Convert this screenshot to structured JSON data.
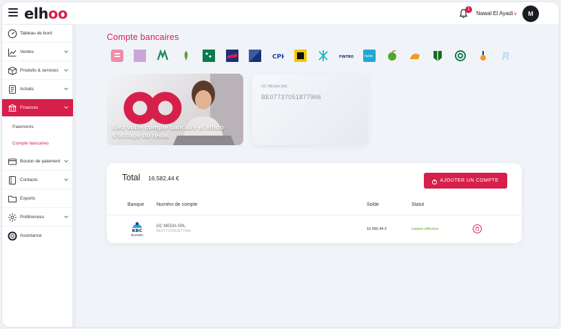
{
  "header": {
    "logo": {
      "prefix": "elh",
      "accent": "oo"
    },
    "notifications_count": "1",
    "user_name": "Nawal El Ayadi",
    "avatar_initials": "M"
  },
  "sidebar": {
    "items": [
      {
        "label": "Tableau de bord",
        "icon": "dashboard-icon",
        "expandable": false
      },
      {
        "label": "Ventes",
        "icon": "chart-line-icon",
        "expandable": true
      },
      {
        "label": "Produits & services",
        "icon": "box-icon",
        "expandable": true
      },
      {
        "label": "Achats",
        "icon": "receipt-icon",
        "expandable": true
      },
      {
        "label": "Finances",
        "icon": "bank-icon",
        "expandable": true,
        "active": true
      },
      {
        "label": "Bouton de paiement",
        "icon": "credit-card-icon",
        "expandable": true
      },
      {
        "label": "Contacts",
        "icon": "contacts-icon",
        "expandable": true
      },
      {
        "label": "Exports",
        "icon": "folder-icon",
        "expandable": false
      },
      {
        "label": "Préférences",
        "icon": "gear-icon",
        "expandable": true
      },
      {
        "label": "Assistance",
        "icon": "lifebuoy-icon",
        "expandable": false
      }
    ],
    "sub_items": [
      {
        "label": "Paiements",
        "active": false
      },
      {
        "label": "Compte bancaires",
        "active": true
      }
    ]
  },
  "main": {
    "title": "Compte bancaires",
    "promo": {
      "text_line1": "Liez votre compte bancaire et elhoo",
      "text_line2": "s'occupe du reste."
    },
    "card": {
      "company": "DC MEDIA SRL",
      "iban": "BE07737051877966"
    },
    "panel": {
      "total_label": "Total",
      "total_value": "16.582,44 €",
      "add_button_label": "AJOUTER UN COMPTE",
      "columns": {
        "bank": "Banque",
        "account": "Numéro de compte",
        "balance": "Solde",
        "status": "Statut"
      },
      "rows": [
        {
          "bank_logo_text": "KBC",
          "bank_logo_sub": "Brussels",
          "company": "DC MEDIA SRL",
          "iban": "BE07737051877966",
          "balance": "16.582,44 €",
          "status": "Liaison effective"
        }
      ]
    }
  },
  "colors": {
    "accent": "#d6204b",
    "status_ok": "#5aaa2d"
  }
}
